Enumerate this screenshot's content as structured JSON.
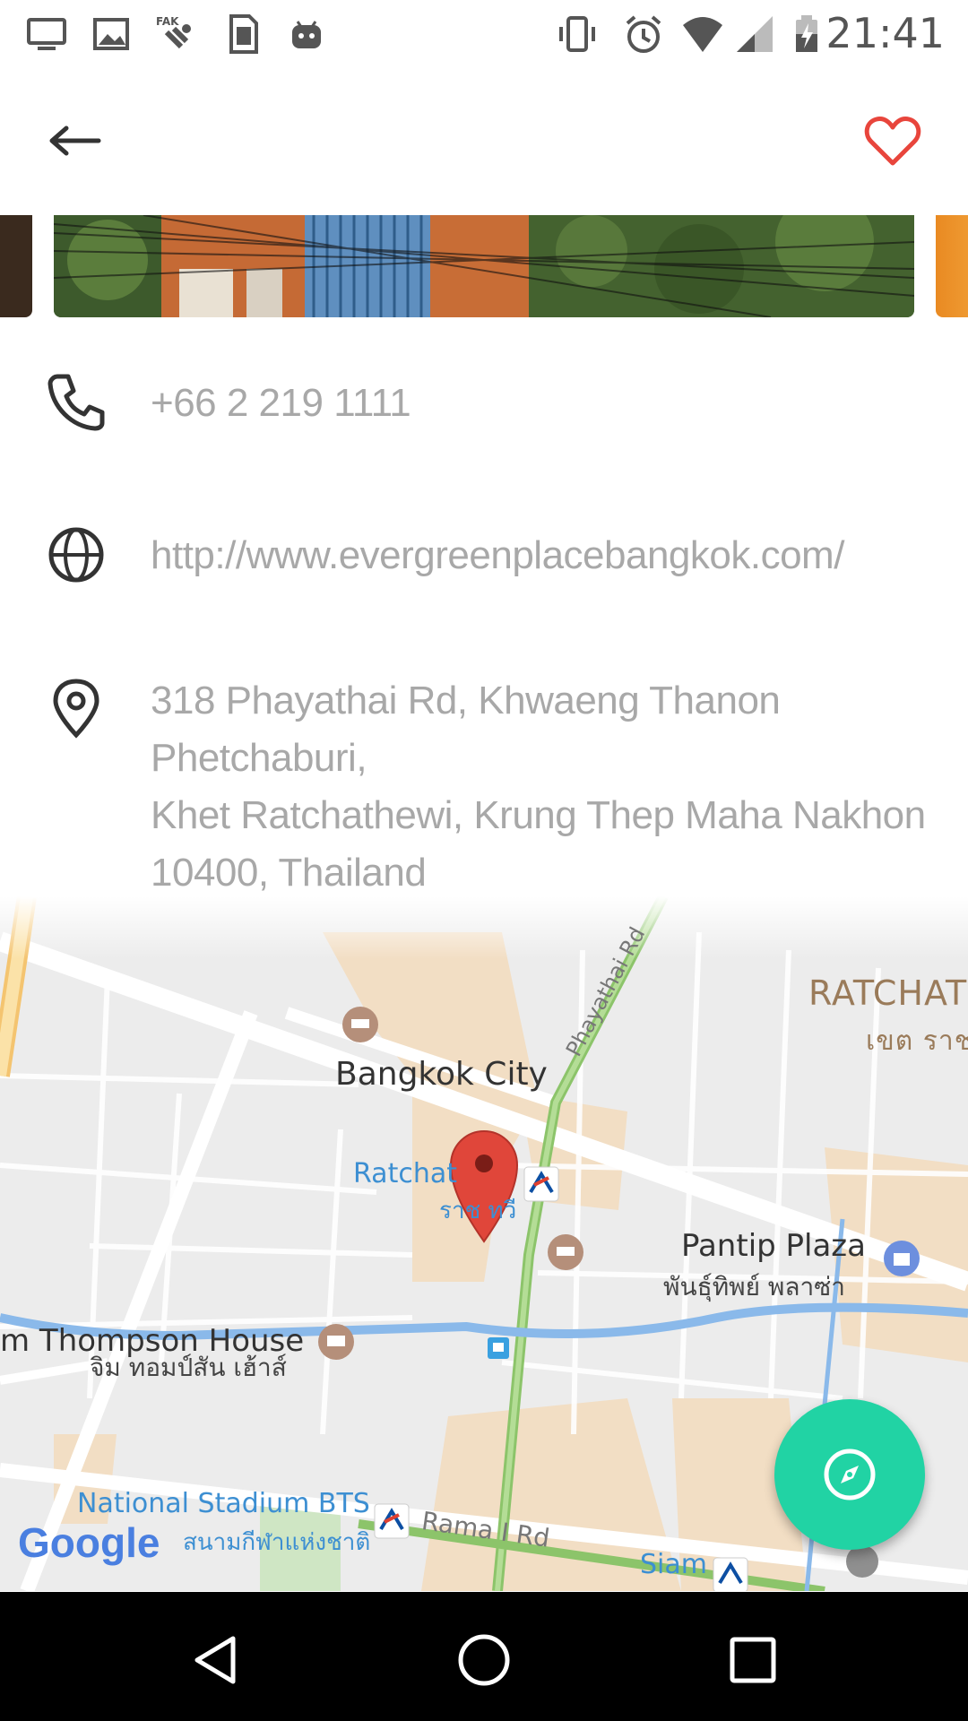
{
  "status_bar": {
    "time": "21:41",
    "icons": [
      "desktop-icon",
      "image-icon",
      "fake-gps-icon",
      "sim-icon",
      "android-icon",
      "vibrate-icon",
      "alarm-icon",
      "wifi-icon",
      "signal-icon",
      "battery-icon"
    ]
  },
  "toolbar": {
    "back_icon": "arrow-left-icon",
    "favorite_icon": "heart-outline-icon",
    "favorite_color": "#e8453c"
  },
  "contact": {
    "phone": "+66 2 219 1111",
    "website": "http://www.evergreenplacebangkok.com/",
    "address_lines": [
      "318 Phayathai Rd, Khwaeng Thanon Phetchaburi,",
      "Khet Ratchathewi, Krung Thep Maha Nakhon",
      "10400, Thailand"
    ]
  },
  "map": {
    "labels": {
      "bangkok_city": "Bangkok City",
      "ratchathewi": "Ratchat",
      "ratchathewi_thai": "ราช  ทวี",
      "phayathai_rd": "Phayathai Rd",
      "ratchathewi_district": "RATCHAT",
      "ratchathewi_district_thai": "เขต ราช",
      "pantip_plaza": "Pantip Plaza",
      "pantip_plaza_thai": "พันธุ์ทิพย์ พลาซ่า",
      "jim_thompson": "m Thompson House",
      "jim_thompson_thai": "จิม ทอมป์สัน เฮ้าส์",
      "national_stadium": "National Stadium BTS",
      "national_stadium_thai": "สนามกีฬาแห่งชาติ",
      "rama_rd": "Rama I Rd",
      "siam": "Siam",
      "google": "Google"
    },
    "fab_icon": "compass-icon",
    "fab_color": "#21d3a4",
    "marker_color": "#e0463a"
  },
  "nav_bar": {
    "back": "back-triangle-icon",
    "home": "home-circle-icon",
    "recents": "recents-square-icon"
  }
}
